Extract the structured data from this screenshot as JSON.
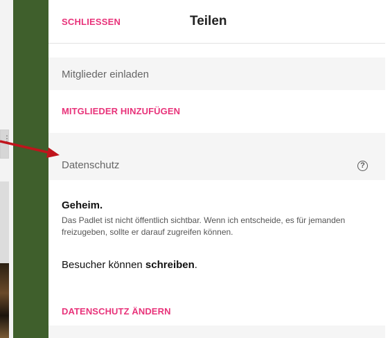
{
  "header": {
    "close_label": "SCHLIESSEN",
    "title": "Teilen"
  },
  "members": {
    "section_label": "Mitglieder einladen",
    "add_label": "MITGLIEDER HINZUFÜGEN"
  },
  "privacy": {
    "section_label": "Datenschutz",
    "help_icon": "help-circle-icon",
    "level": "Geheim.",
    "description": "Das Padlet ist nicht öffentlich sichtbar. Wenn ich entscheide, es für jemanden freizugeben, sollte er darauf zugreifen können.",
    "visitors_prefix": "Besucher können ",
    "visitors_permission": "schreiben",
    "visitors_suffix": ".",
    "change_label": "DATENSCHUTZ ÄNDERN"
  },
  "colors": {
    "accent": "#e8337a",
    "section_bg": "#f5f5f5",
    "annotation_arrow": "#c0141c",
    "sidebar_green": "#3f5f2c"
  }
}
